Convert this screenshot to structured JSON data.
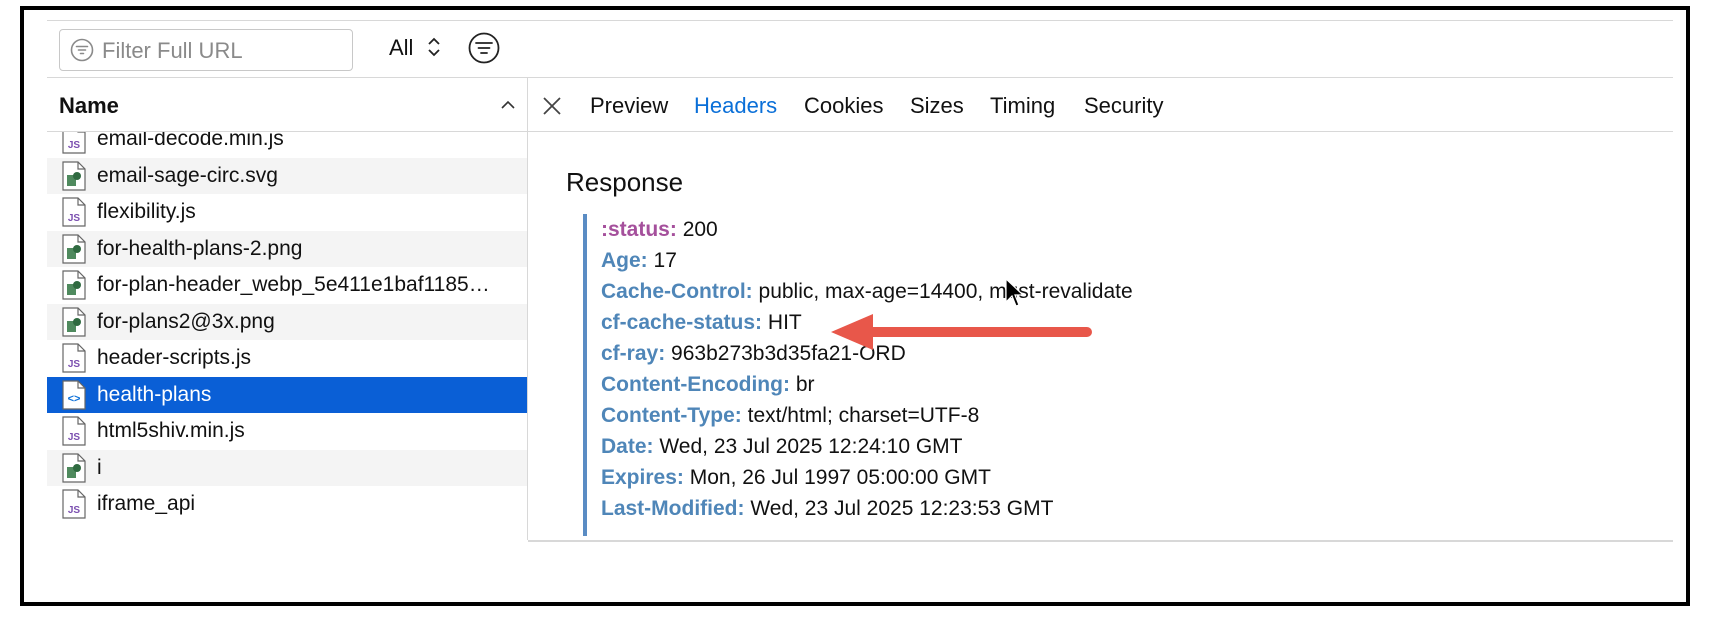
{
  "toolbar": {
    "filter_placeholder": "Filter Full URL",
    "scope_value": "All"
  },
  "file_list": {
    "header": "Name",
    "items": [
      {
        "name": "email-decode.min.js",
        "type": "js"
      },
      {
        "name": "email-sage-circ.svg",
        "type": "image"
      },
      {
        "name": "flexibility.js",
        "type": "js"
      },
      {
        "name": "for-health-plans-2.png",
        "type": "image"
      },
      {
        "name": "for-plan-header_webp_5e411e1baf1185…",
        "type": "image"
      },
      {
        "name": "for-plans2@3x.png",
        "type": "image"
      },
      {
        "name": "header-scripts.js",
        "type": "js"
      },
      {
        "name": "health-plans",
        "type": "html",
        "selected": true
      },
      {
        "name": "html5shiv.min.js",
        "type": "js"
      },
      {
        "name": "i",
        "type": "image"
      },
      {
        "name": "iframe_api",
        "type": "js"
      }
    ]
  },
  "tabs": [
    "Preview",
    "Headers",
    "Cookies",
    "Sizes",
    "Timing",
    "Security"
  ],
  "active_tab": "Headers",
  "response": {
    "title": "Response",
    "headers": [
      {
        "key": ":status:",
        "value": "200",
        "pseudo": true
      },
      {
        "key": "Age:",
        "value": "17"
      },
      {
        "key": "Cache-Control:",
        "value": "public, max-age=14400, must-revalidate"
      },
      {
        "key": "cf-cache-status:",
        "value": "HIT"
      },
      {
        "key": "cf-ray:",
        "value": "963b273b3d35fa21-ORD"
      },
      {
        "key": "Content-Encoding:",
        "value": "br"
      },
      {
        "key": "Content-Type:",
        "value": "text/html; charset=UTF-8"
      },
      {
        "key": "Date:",
        "value": "Wed, 23 Jul 2025 12:24:10 GMT"
      },
      {
        "key": "Expires:",
        "value": "Mon, 26 Jul 1997 05:00:00 GMT"
      },
      {
        "key": "Last-Modified:",
        "value": "Wed, 23 Jul 2025 12:23:53 GMT"
      }
    ]
  },
  "colors": {
    "accent": "#0a6fd8",
    "selected_row": "#0a5fd6",
    "header_key": "#4f86b8",
    "pseudo_key": "#a5509c",
    "annotation_arrow": "#e8574a"
  }
}
